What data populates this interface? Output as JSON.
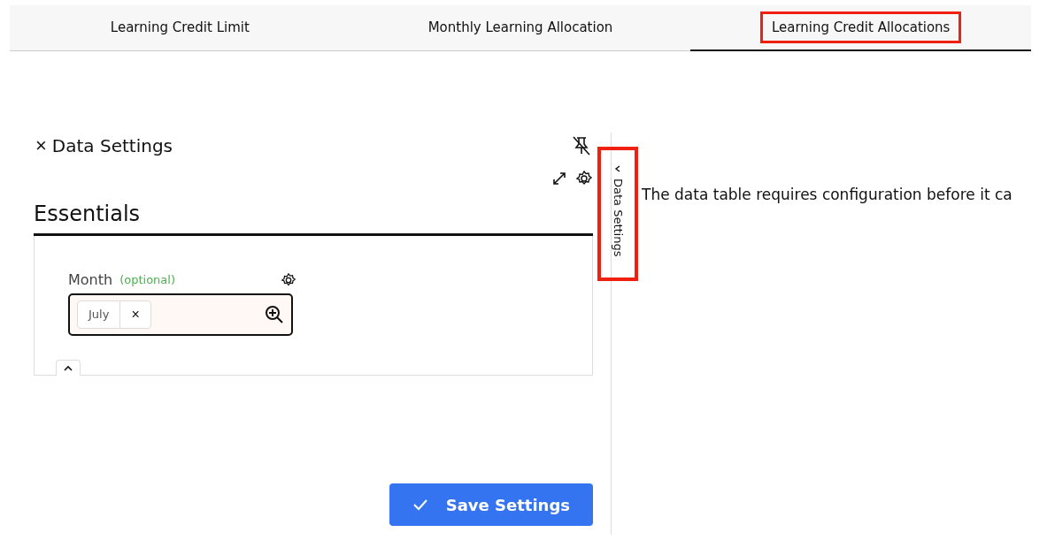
{
  "tabs": [
    {
      "label": "Learning Credit Limit",
      "selected": false,
      "highlighted": false
    },
    {
      "label": "Monthly Learning Allocation",
      "selected": false,
      "highlighted": false
    },
    {
      "label": "Learning Credit Allocations",
      "selected": true,
      "highlighted": true
    }
  ],
  "panel": {
    "close_icon": "×",
    "title": "Data Settings",
    "section": "Essentials",
    "field": {
      "label": "Month",
      "hint": "(optional)",
      "chips": [
        {
          "label": "July",
          "remove": "×"
        }
      ]
    },
    "save_button": "Save Settings"
  },
  "side_tab": {
    "label": "Data Settings",
    "highlighted": true
  },
  "message": "The data table requires configuration before it ca"
}
